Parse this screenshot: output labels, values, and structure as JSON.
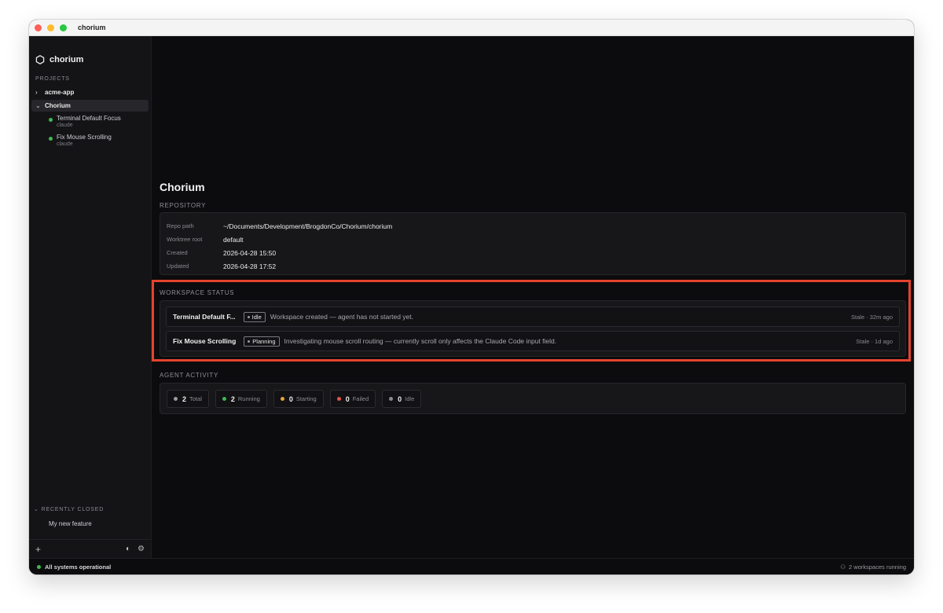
{
  "window": {
    "title": "chorium"
  },
  "sidebar": {
    "brand": "chorium",
    "projects_label": "PROJECTS",
    "projects": [
      {
        "name": "acme-app",
        "expanded": false
      },
      {
        "name": "Chorium",
        "expanded": true,
        "workspaces": [
          {
            "name": "Terminal Default Focus",
            "agent": "claude"
          },
          {
            "name": "Fix Mouse Scrolling",
            "agent": "claude"
          }
        ]
      }
    ],
    "recently_closed_label": "RECENTLY CLOSED",
    "recently_closed": [
      "My new feature"
    ]
  },
  "main": {
    "title": "Chorium",
    "repository": {
      "label": "REPOSITORY",
      "rows": [
        {
          "key": "Repo path",
          "value": "~/Documents/Development/BrogdonCo/Chorium/chorium"
        },
        {
          "key": "Worktree root",
          "value": "default"
        },
        {
          "key": "Created",
          "value": "2026-04-28 15:50"
        },
        {
          "key": "Updated",
          "value": "2026-04-28 17:52"
        }
      ]
    },
    "workspace_status": {
      "label": "WORKSPACE STATUS",
      "rows": [
        {
          "name": "Terminal Default F...",
          "state": "Idle",
          "desc": "Workspace created — agent has not started yet.",
          "time": "Stale · 32m ago"
        },
        {
          "name": "Fix Mouse Scrolling",
          "state": "Planning",
          "desc": "Investigating mouse scroll routing — currently scroll only affects the Claude Code input field.",
          "time": "Stale · 1d ago"
        }
      ]
    },
    "agent_activity": {
      "label": "AGENT ACTIVITY",
      "chips": [
        {
          "count": "2",
          "label": "Total",
          "color": "#9a9aa0"
        },
        {
          "count": "2",
          "label": "Running",
          "color": "#3fb950"
        },
        {
          "count": "0",
          "label": "Starting",
          "color": "#e8a33d"
        },
        {
          "count": "0",
          "label": "Failed",
          "color": "#e5534b"
        },
        {
          "count": "0",
          "label": "Idle",
          "color": "#8a8a90"
        }
      ]
    }
  },
  "statusbar": {
    "left": "All systems operational",
    "right": "2 workspaces running"
  },
  "colors": {
    "highlight": "#e5432d",
    "ok": "#3fb950"
  }
}
